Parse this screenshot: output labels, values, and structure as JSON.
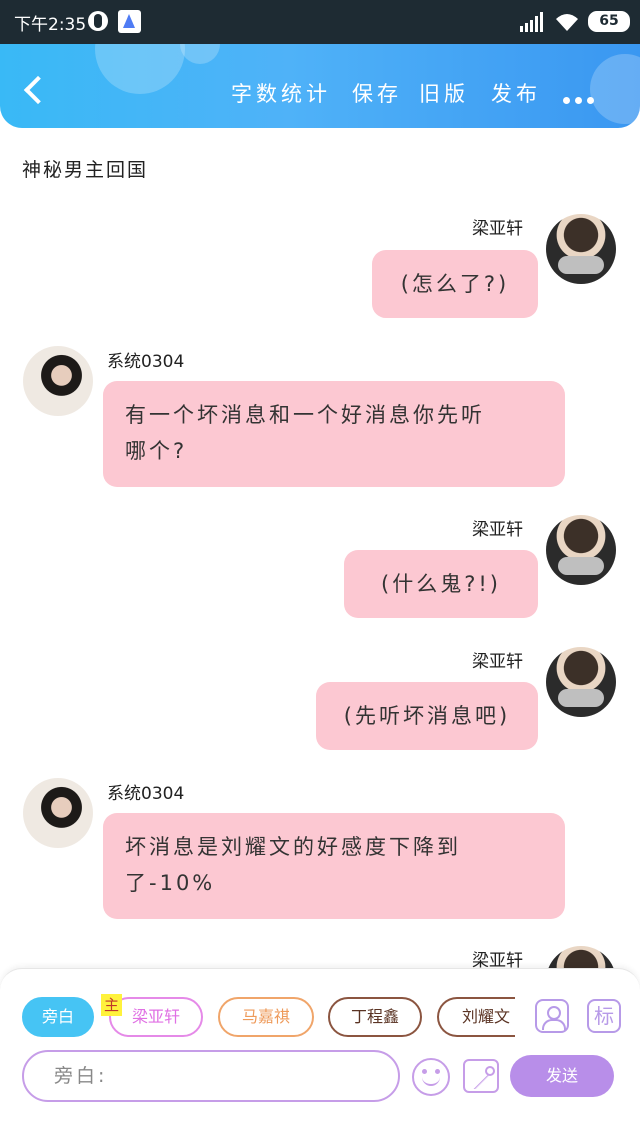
{
  "status_bar": {
    "time": "下午2:35",
    "battery": "65"
  },
  "header": {
    "actions": [
      "字数统计",
      "保存",
      "旧版",
      "发布"
    ]
  },
  "document": {
    "title": "神秘男主回国"
  },
  "messages": [
    {
      "side": "right",
      "sender": "梁亚轩",
      "text": "(怎么了?)"
    },
    {
      "side": "left",
      "sender": "系统0304",
      "lines": [
        "有一个坏消息和一个好消息你先听",
        "哪个?"
      ]
    },
    {
      "side": "right",
      "sender": "梁亚轩",
      "text": "(什么鬼?!)"
    },
    {
      "side": "right",
      "sender": "梁亚轩",
      "text": "(先听坏消息吧)"
    },
    {
      "side": "left",
      "sender": "系统0304",
      "lines": [
        "坏消息是刘耀文的好感度下降到",
        "了-10%"
      ]
    },
    {
      "side": "right",
      "sender": "梁亚轩"
    }
  ],
  "composer": {
    "roles": [
      "旁白",
      "梁亚轩",
      "马嘉祺",
      "丁程鑫",
      "刘耀文"
    ],
    "main_tag": "主",
    "mark_button": "标",
    "input_placeholder": "旁白:",
    "send_label": "发送"
  },
  "colors": {
    "header": "#3aaef5",
    "bubble": "#fcc8d2",
    "narrator_role": "#46c4f4",
    "send_button": "#b88ee9"
  }
}
